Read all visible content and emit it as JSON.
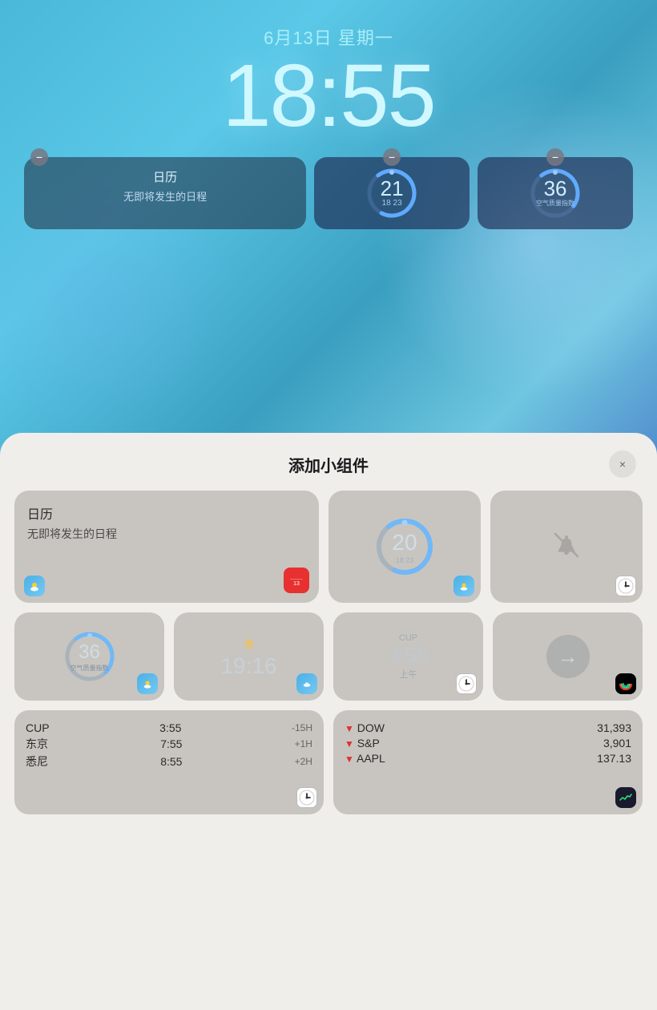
{
  "background": {
    "gradient": "blue-teal"
  },
  "lockscreen": {
    "date": "6月13日 星期一",
    "time": "18:55",
    "widgets": {
      "calendar": {
        "title": "日历",
        "subtitle": "无即将发生的日程"
      },
      "temperature": {
        "value": "21",
        "low": "18",
        "high": "23"
      },
      "aqi": {
        "value": "36",
        "label": "空气质量指数"
      }
    }
  },
  "sheet": {
    "title": "添加小组件",
    "close_label": "×",
    "widgets": {
      "row1": {
        "calendar": {
          "title": "日历",
          "subtitle": "无即将发生的日程"
        },
        "temp_gauge": {
          "value": "20",
          "low": "18",
          "high": "23"
        },
        "silent": {
          "icon": "bell-slash"
        }
      },
      "row2": {
        "aqi": {
          "value": "36",
          "label": "空气质量指数"
        },
        "time1": {
          "value": "19:16"
        },
        "cup_time": {
          "city": "CUP",
          "time": "3:55",
          "ampm": "上午"
        },
        "arrow": {
          "icon": "arrow-right"
        }
      },
      "row3": {
        "worldclock": {
          "rows": [
            {
              "city": "CUP",
              "time": "3:55",
              "offset": "-15H"
            },
            {
              "city": "东京",
              "time": "7:55",
              "offset": "+1H"
            },
            {
              "city": "悉尼",
              "time": "8:55",
              "offset": "+2H"
            }
          ]
        },
        "stocks": {
          "rows": [
            {
              "name": "▼ DOW",
              "value": "31,393"
            },
            {
              "name": "▼ S&P",
              "value": "3,901"
            },
            {
              "name": "▼ AAPL",
              "value": "137.13"
            }
          ]
        }
      }
    }
  }
}
